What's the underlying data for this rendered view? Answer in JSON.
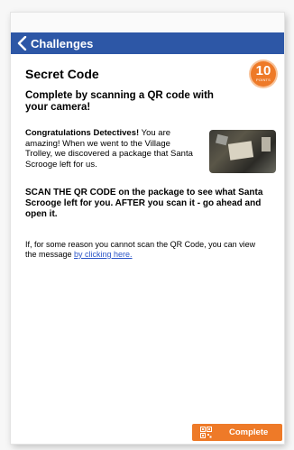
{
  "navbar": {
    "back_label": "Challenges",
    "color": "#2d57a6"
  },
  "challenge": {
    "title": "Secret Code",
    "points": "10",
    "points_label": "POINTS",
    "subtitle": "Complete by scanning a QR code with your camera!",
    "story_lead": "Congratulations Detectives!",
    "story_body": " You are amazing! When we went to the Village Trolley, we discovered a package that Santa Scrooge left for us.",
    "instructions": "SCAN THE QR CODE on the package to see what Santa Scrooge left for you. AFTER you scan it - go ahead and open it.",
    "fallback_text": "If, for some reason you cannot scan the QR Code, you can view the message ",
    "fallback_link": "by clicking here."
  },
  "complete_button": {
    "label": "Complete",
    "color": "#ee7a28",
    "icon": "qr-code-icon"
  }
}
